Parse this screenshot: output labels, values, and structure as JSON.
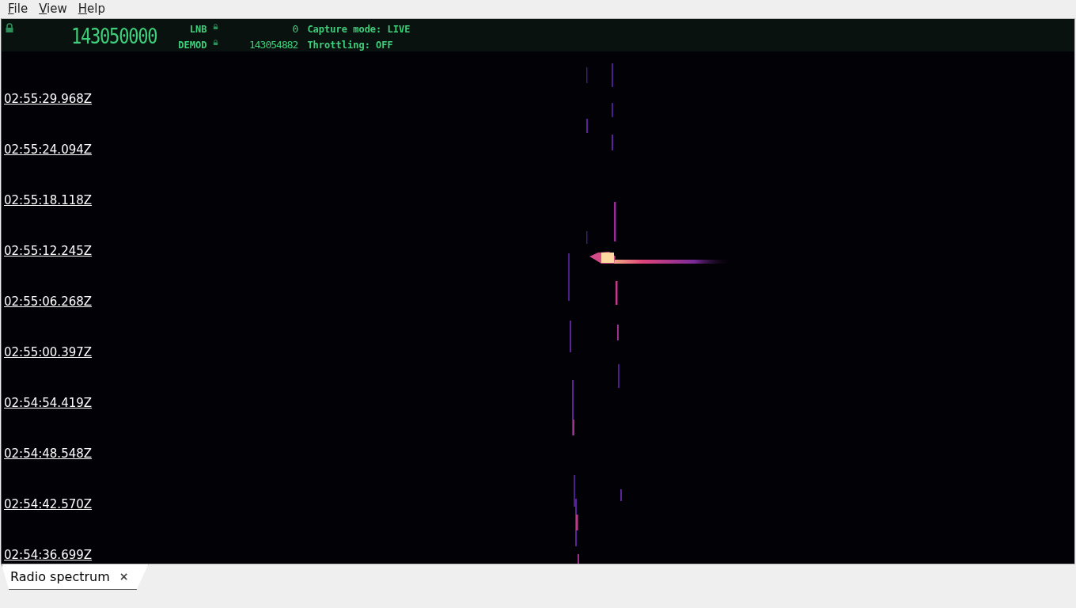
{
  "menu": [
    {
      "label": "File",
      "mnemonic_underlined": true
    },
    {
      "label": "View",
      "mnemonic_underlined": true
    },
    {
      "label": "Help",
      "mnemonic_underlined": true
    }
  ],
  "header": {
    "locked": true,
    "frequency": "143050000",
    "rows": [
      {
        "label": "LNB",
        "locked": true,
        "value": "0"
      },
      {
        "label": "DEMOD",
        "locked": true,
        "value": "143054882"
      }
    ],
    "status": [
      "Capture mode: LIVE",
      "Throttling: OFF"
    ]
  },
  "timestamps": [
    "02:55:29.968Z",
    "02:55:24.094Z",
    "02:55:18.118Z",
    "02:55:12.245Z",
    "02:55:06.268Z",
    "02:55:00.397Z",
    "02:54:54.419Z",
    "02:54:48.548Z",
    "02:54:42.570Z",
    "02:54:36.699Z"
  ],
  "tabs": [
    {
      "label": "Radio spectrum",
      "selected": true,
      "close": "×"
    }
  ]
}
